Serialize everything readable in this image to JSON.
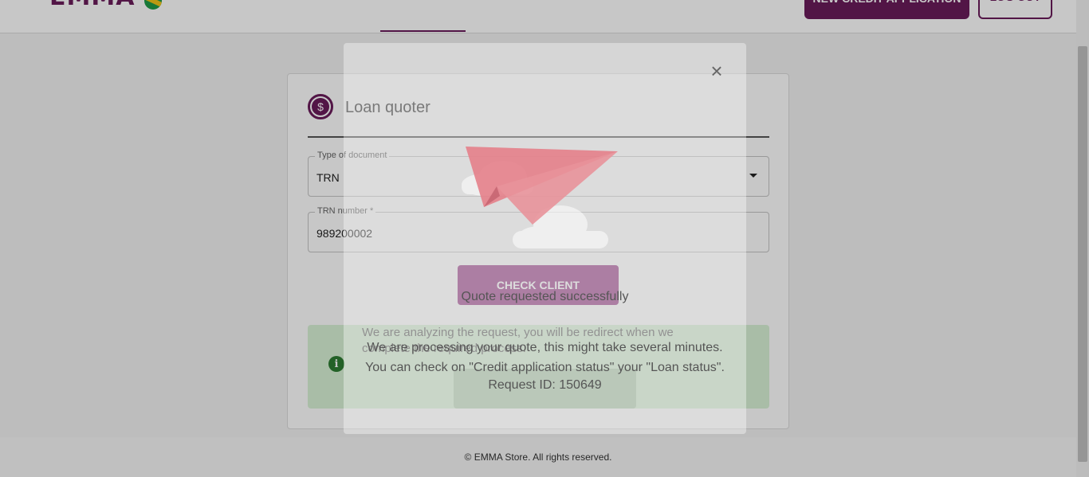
{
  "header": {
    "logo_text": "EMMA",
    "flag_icon": "jamaica-flag-icon",
    "new_application_label": "NEW CREDIT APPLICATION",
    "logout_label": "LOG OUT"
  },
  "card": {
    "icon": "dollar-icon",
    "title": "Loan quoter",
    "document_type": {
      "label": "Type of document",
      "value": "TRN"
    },
    "trn_number": {
      "label": "TRN number *",
      "value": "989200002"
    },
    "check_button": "CHECK CLIENT",
    "alert": {
      "icon": "info-icon",
      "text": "We are analyzing the request, you will be redirect when we complete the required process."
    }
  },
  "footer": {
    "copyright": "© EMMA Store. All rights reserved."
  },
  "modal": {
    "close_icon": "close-icon",
    "illustration": "paper-plane-icon",
    "title": "Quote requested successfully",
    "message": "We are processing your quote, this might take several minutes. You can check on \"Credit application status\" your \"Loan status\".",
    "request_id": "Request ID: 150649"
  },
  "colors": {
    "brand": "#6a1b5a",
    "accent_button": "#9b3e8a",
    "alert_bg": "#d9f2d6",
    "plane": "#e07a85"
  }
}
